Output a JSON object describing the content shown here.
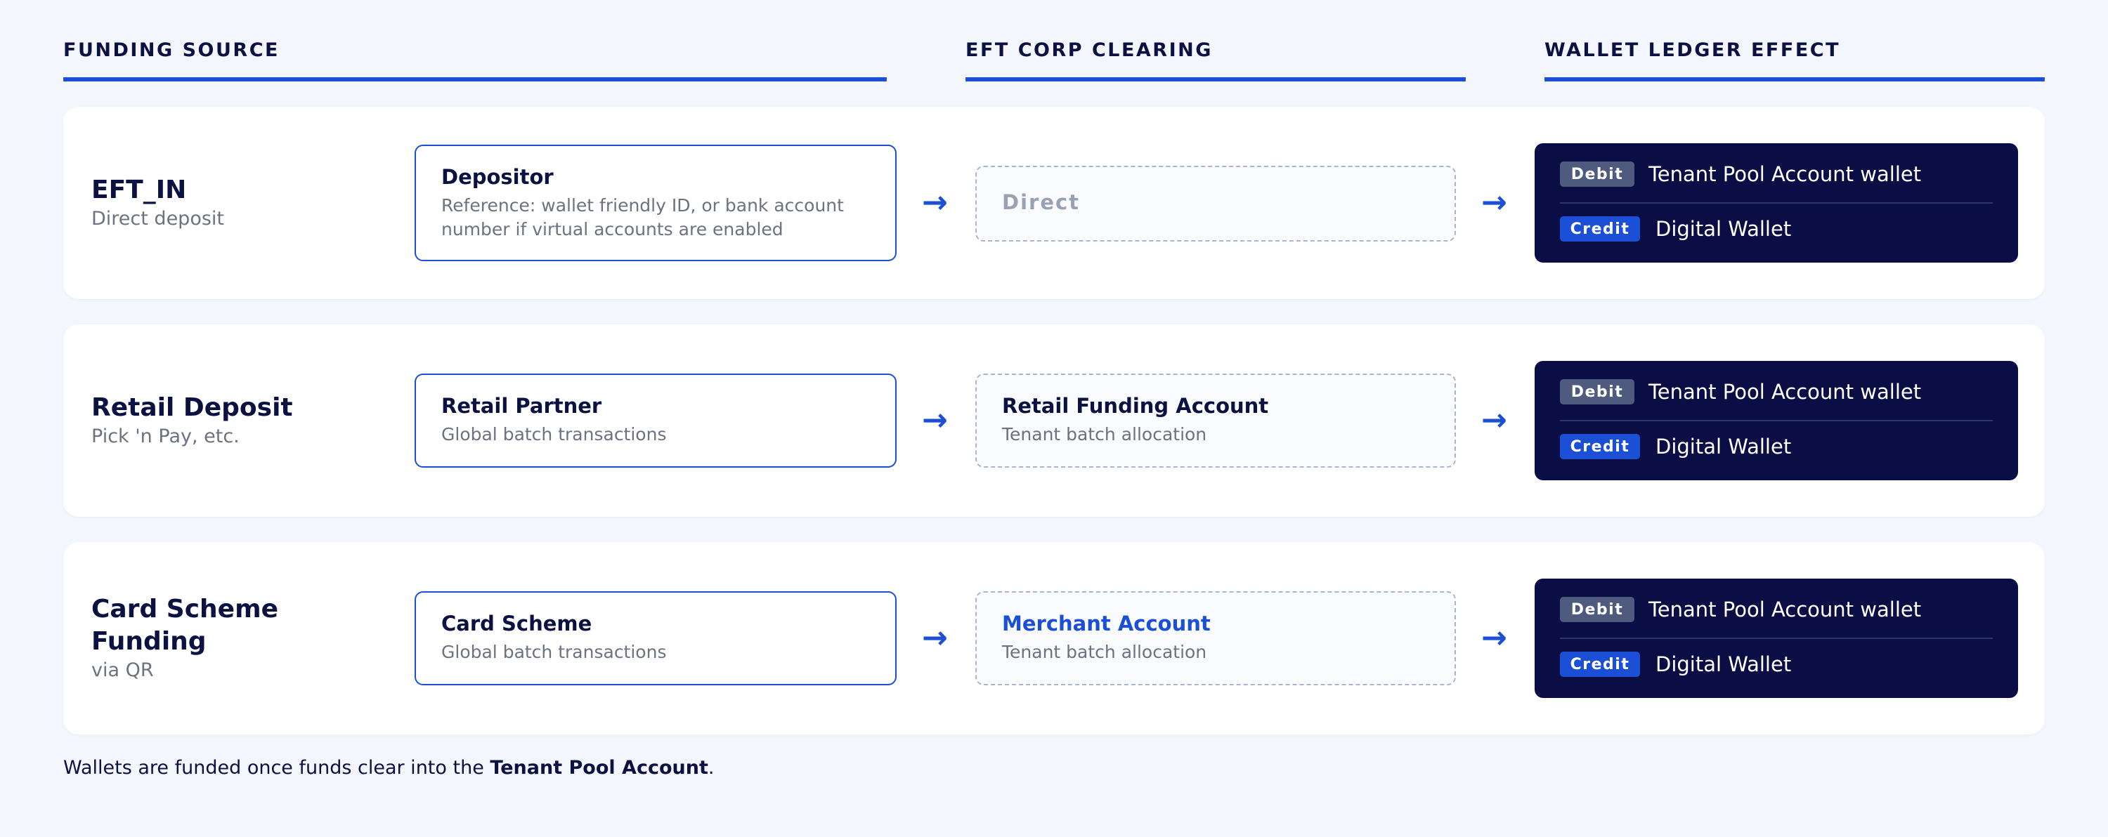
{
  "headers": {
    "funding_source": "FUNDING SOURCE",
    "eft_corp_clearing": "EFT CORP CLEARING",
    "wallet_ledger_effect": "WALLET LEDGER EFFECT"
  },
  "rows": [
    {
      "source_title": "EFT_IN",
      "source_sub": "Direct deposit",
      "party_title": "Depositor",
      "party_desc": "Reference: wallet friendly ID, or bank account number if virtual accounts are enabled",
      "clearing_title": "Direct",
      "clearing_desc": "",
      "debit_badge": "Debit",
      "debit_text": "Tenant Pool Account wallet",
      "credit_badge": "Credit",
      "credit_text": "Digital Wallet"
    },
    {
      "source_title": "Retail Deposit",
      "source_sub": "Pick 'n Pay, etc.",
      "party_title": "Retail Partner",
      "party_desc": "Global batch transactions",
      "clearing_title": "Retail Funding Account",
      "clearing_desc": "Tenant batch allocation",
      "debit_badge": "Debit",
      "debit_text": "Tenant Pool Account wallet",
      "credit_badge": "Credit",
      "credit_text": "Digital Wallet"
    },
    {
      "source_title": "Card Scheme Funding",
      "source_sub": "via QR",
      "party_title": "Card Scheme",
      "party_desc": "Global batch transactions",
      "clearing_title": "Merchant Account",
      "clearing_desc": "Tenant batch allocation",
      "debit_badge": "Debit",
      "debit_text": "Tenant Pool Account wallet",
      "credit_badge": "Credit",
      "credit_text": "Digital Wallet"
    }
  ],
  "arrow_glyph": "→",
  "footer": {
    "prefix": "Wallets are funded once funds clear into the ",
    "emphasis": "Tenant Pool Account",
    "suffix": "."
  },
  "colors": {
    "accent": "#1b4fd6",
    "ink": "#0b1140",
    "ledger_bg": "#0a0e45",
    "debit_badge": "#4e5a7e",
    "credit_badge": "#1b4fd6",
    "page_bg": "#f3f7fd"
  }
}
